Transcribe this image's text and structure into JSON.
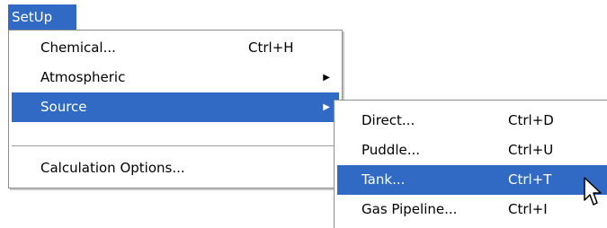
{
  "menu_bar": {
    "setup_label": "SetUp"
  },
  "setup_menu": {
    "items": [
      {
        "label": "Chemical...",
        "shortcut": "Ctrl+H"
      },
      {
        "label": "Atmospheric",
        "arrow": "▶"
      },
      {
        "label": "Source",
        "arrow": "▶"
      },
      {
        "label": "Calculation Options..."
      }
    ]
  },
  "source_submenu": {
    "items": [
      {
        "label": "Direct...",
        "shortcut": "Ctrl+D"
      },
      {
        "label": "Puddle...",
        "shortcut": "Ctrl+U"
      },
      {
        "label": "Tank...",
        "shortcut": "Ctrl+T"
      },
      {
        "label": "Gas Pipeline...",
        "shortcut": "Ctrl+I"
      }
    ]
  },
  "colors": {
    "highlight": "#316ac5",
    "highlight_text": "#ffffff"
  },
  "icons": {
    "pointer": "mouse-pointer-icon"
  }
}
